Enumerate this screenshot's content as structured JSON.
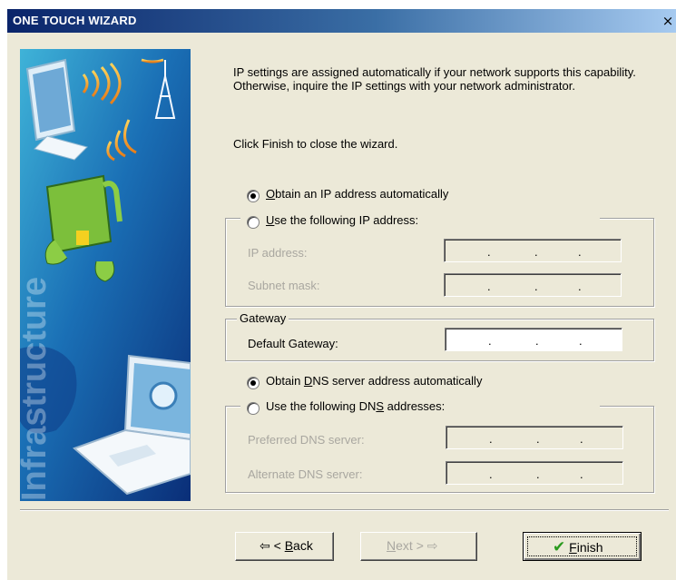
{
  "window": {
    "title": "ONE TOUCH WIZARD",
    "close_glyph": "×"
  },
  "side_image": {
    "vertical_text": "Infrastructure"
  },
  "info": {
    "paragraph": "IP settings are assigned automatically if your network supports this capability. Otherwise, inquire the IP settings with your network administrator.",
    "finish_hint": "Click Finish to close the wizard."
  },
  "ip": {
    "auto_label_first": "O",
    "auto_label_rest": "btain an IP address automatically",
    "manual_label_first": "U",
    "manual_label_rest": "se the following IP address:",
    "ip_address_label": "IP address:",
    "subnet_mask_label": "Subnet mask:",
    "selected": "auto"
  },
  "gateway": {
    "group_label": "Gateway",
    "default_gateway_label": "Default Gateway:"
  },
  "dns": {
    "auto_label_pre": "Obtain ",
    "auto_label_key": "D",
    "auto_label_post": "NS server address automatically",
    "manual_label_pre": "Use the following DN",
    "manual_label_key": "S",
    "manual_label_post": " addresses:",
    "preferred_label": "Preferred DNS server:",
    "alternate_label": "Alternate DNS server:",
    "selected": "auto"
  },
  "ip_field": {
    "dot": "."
  },
  "buttons": {
    "back_arrow": "⇦",
    "back_pre": "< ",
    "back_key": "B",
    "back_post": "ack",
    "next_key": "N",
    "next_post": "ext >",
    "next_arrow": "⇨",
    "finish_check": "✔",
    "finish_key": "F",
    "finish_post": "inish"
  },
  "colors": {
    "title_start": "#0a246a",
    "title_end": "#a6caf0",
    "face": "#ece9d8",
    "disabled_text": "#a9a7a0"
  }
}
